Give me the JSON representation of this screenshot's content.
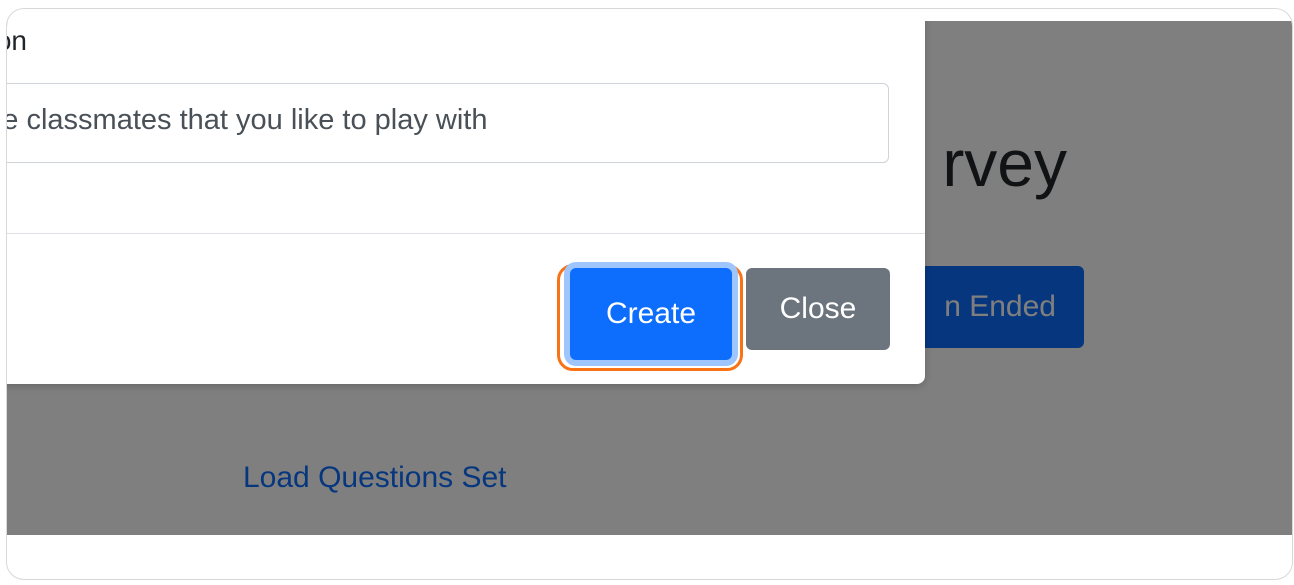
{
  "page": {
    "heading": "rvey",
    "open_ended_button": "n Ended",
    "load_questions_link": "Load Questions Set"
  },
  "modal": {
    "field_label": "on",
    "question_input_value": "t the classmates that you like to play with",
    "create_button": "Create",
    "close_button": "Close"
  },
  "colors": {
    "primary": "#0d6efd",
    "secondary": "#6c757d",
    "focus_ring": "#f97316",
    "backdrop": "rgba(0,0,0,0.5)"
  }
}
